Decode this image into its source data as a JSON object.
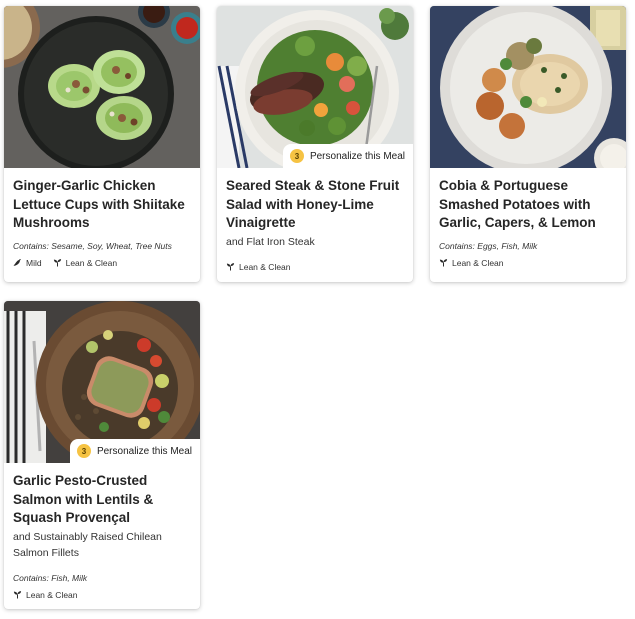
{
  "colors": {
    "badge_accent": "#f6c343",
    "card_background": "#ffffff",
    "text": "#262626"
  },
  "meals": [
    {
      "title": "Ginger-Garlic Chicken Lettuce Cups with Shiitake Mushrooms",
      "contains": "Contains: Sesame, Soy, Wheat, Tree Nuts",
      "tags": [
        {
          "label": "Mild",
          "icon": "pepper-icon"
        },
        {
          "label": "Lean & Clean",
          "icon": "sprout-icon"
        }
      ]
    },
    {
      "title": "Seared Steak & Stone Fruit Salad with Honey-Lime Vinaigrette",
      "subtitle": "and Flat Iron Steak",
      "personalize": {
        "count": "3",
        "label": "Personalize this Meal"
      },
      "tags": [
        {
          "label": "Lean & Clean",
          "icon": "sprout-icon"
        }
      ]
    },
    {
      "title": "Cobia & Portuguese Smashed Potatoes with Garlic, Capers, & Lemon",
      "contains": "Contains: Eggs, Fish, Milk",
      "tags": [
        {
          "label": "Lean & Clean",
          "icon": "sprout-icon"
        }
      ]
    },
    {
      "title": "Garlic Pesto-Crusted Salmon with Lentils & Squash Provençal",
      "subtitle": "and Sustainably Raised Chilean Salmon Fillets",
      "personalize": {
        "count": "3",
        "label": "Personalize this Meal"
      },
      "contains": "Contains: Fish, Milk",
      "tags": [
        {
          "label": "Lean & Clean",
          "icon": "sprout-icon"
        }
      ]
    }
  ]
}
